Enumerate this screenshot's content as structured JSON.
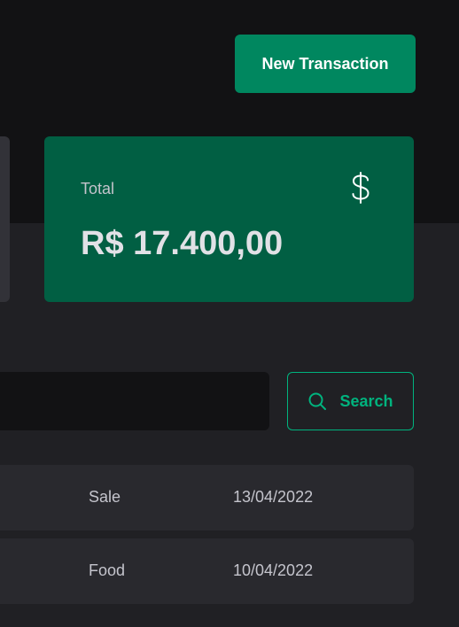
{
  "header": {
    "new_transaction_label": "New Transaction"
  },
  "summary": {
    "total": {
      "label": "Total",
      "value": "R$ 17.400,00",
      "icon": "dollar-sign-icon",
      "bg_color": "#015f43"
    }
  },
  "search": {
    "placeholder": "",
    "button_label": "Search",
    "button_icon": "magnifier-icon",
    "accent_color": "#00b37e"
  },
  "transactions": [
    {
      "category": "Sale",
      "date": "13/04/2022"
    },
    {
      "category": "Food",
      "date": "10/04/2022"
    }
  ]
}
